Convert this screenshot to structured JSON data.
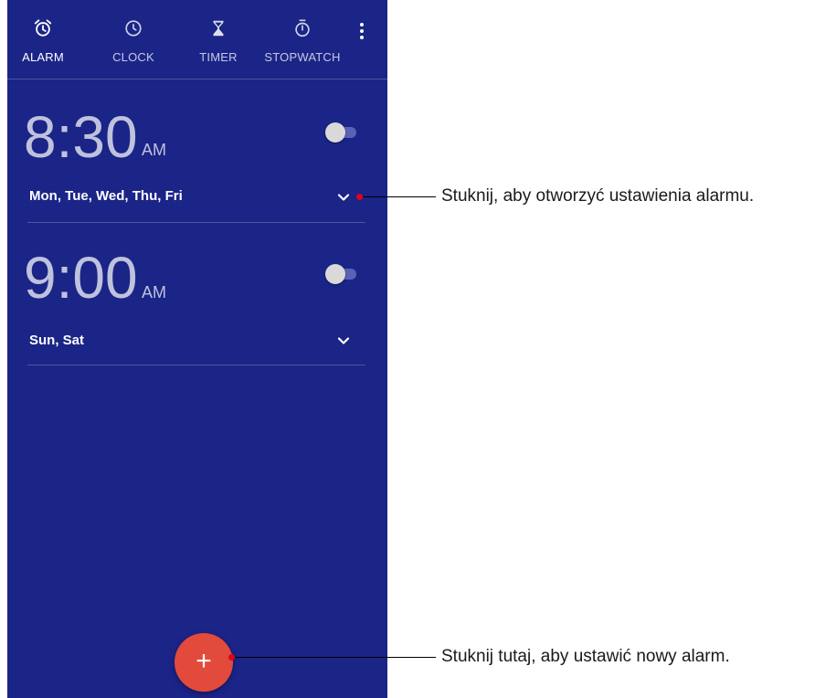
{
  "tabs": [
    {
      "label": "ALARM",
      "icon": "alarm-clock-icon",
      "active": true
    },
    {
      "label": "CLOCK",
      "icon": "clock-icon",
      "active": false
    },
    {
      "label": "TIMER",
      "icon": "hourglass-icon",
      "active": false
    },
    {
      "label": "STOPWATCH",
      "icon": "stopwatch-icon",
      "active": false
    }
  ],
  "alarms": [
    {
      "time": "8:30",
      "ampm": "AM",
      "days": "Mon, Tue, Wed, Thu, Fri",
      "enabled": false
    },
    {
      "time": "9:00",
      "ampm": "AM",
      "days": "Sun, Sat",
      "enabled": false
    }
  ],
  "fab": {
    "label": "+"
  },
  "callouts": {
    "settings": "Stuknij, aby otworzyć ustawienia alarmu.",
    "new_alarm": "Stuknij tutaj, aby ustawić nowy alarm."
  },
  "colors": {
    "background": "#1b2487",
    "fab": "#e24a3b",
    "callout_dot": "#e3001b",
    "toggle_track": "#5a62b7"
  }
}
